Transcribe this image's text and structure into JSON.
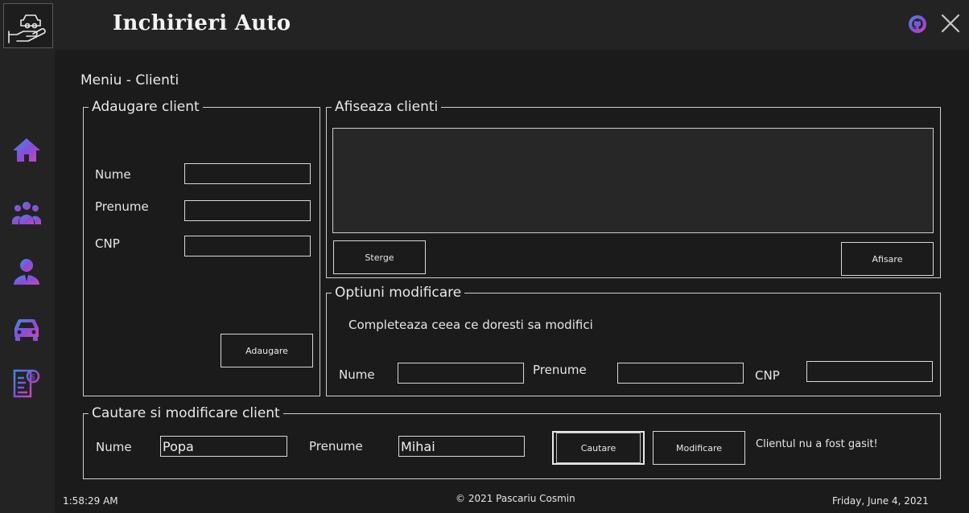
{
  "app": {
    "title": "Inchirieri Auto",
    "accent_gradient": [
      "#3b8fe8",
      "#8a4bd6",
      "#c64bb8"
    ]
  },
  "titlebar": {
    "logo_icon": "car-in-hand-icon",
    "github_icon": "github-icon",
    "close_icon": "close-icon"
  },
  "sidebar": {
    "items": [
      {
        "icon": "home-icon"
      },
      {
        "icon": "clients-icon"
      },
      {
        "icon": "employee-icon"
      },
      {
        "icon": "car-icon"
      },
      {
        "icon": "invoice-icon"
      }
    ]
  },
  "page": {
    "title": "Meniu - Clienti"
  },
  "add_client": {
    "legend": "Adaugare client",
    "nume_label": "Nume",
    "prenume_label": "Prenume",
    "cnp_label": "CNP",
    "nume_value": "",
    "prenume_value": "",
    "cnp_value": "",
    "add_button": "Adaugare"
  },
  "show_clients": {
    "legend": "Afiseaza clienti",
    "delete_button": "Sterge",
    "show_button": "Afisare"
  },
  "modify_options": {
    "legend": "Optiuni modificare",
    "hint": "Completeaza ceea ce doresti sa modifici",
    "nume_label": "Nume",
    "prenume_label": "Prenume",
    "cnp_label": "CNP",
    "nume_value": "",
    "prenume_value": "",
    "cnp_value": ""
  },
  "search_modify": {
    "legend": "Cautare si modificare client",
    "nume_label": "Nume",
    "prenume_label": "Prenume",
    "nume_value": "Popa",
    "prenume_value": "Mihai",
    "search_button": "Cautare",
    "modify_button": "Modificare",
    "status": "Clientul nu a fost gasit!"
  },
  "footer": {
    "time": "1:58:29 AM",
    "copyright": "© 2021 Pascariu Cosmin",
    "date": "Friday, June 4, 2021"
  }
}
